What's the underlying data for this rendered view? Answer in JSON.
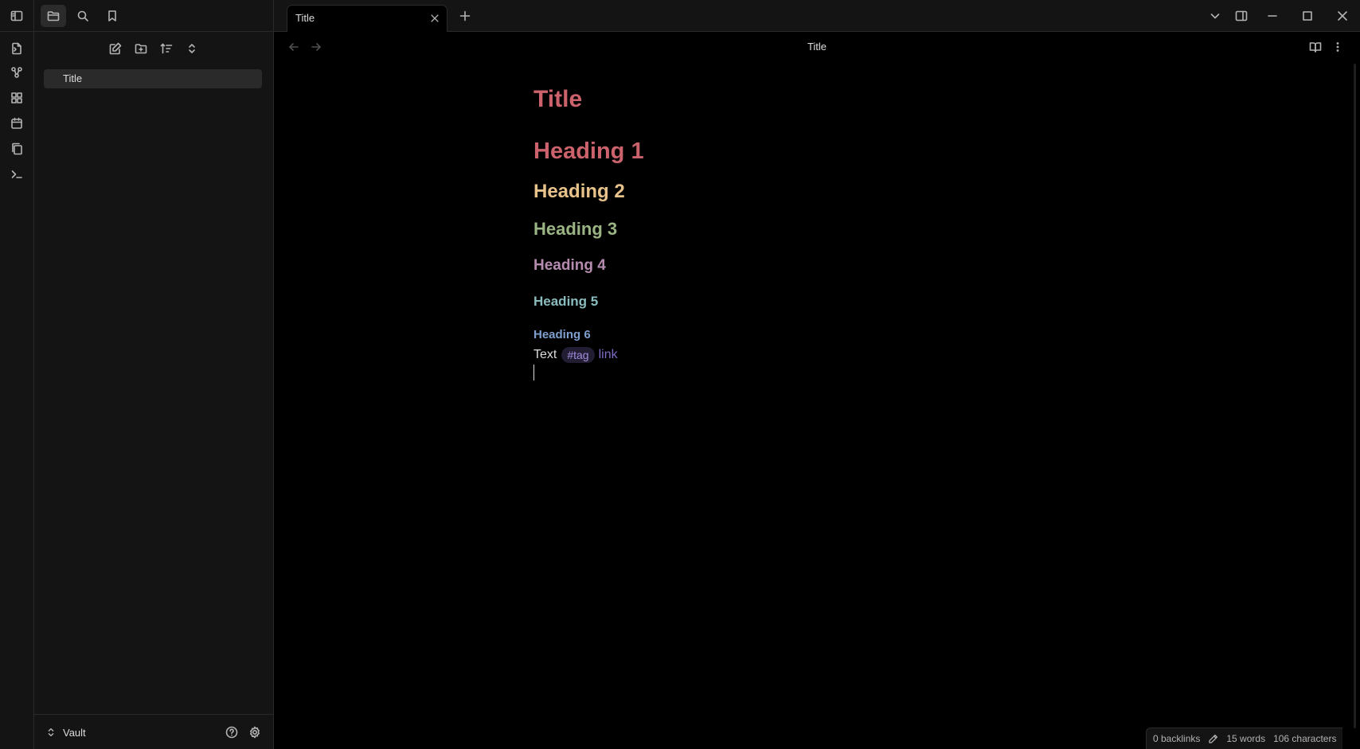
{
  "ribbon": {
    "items": [
      {
        "icon": "open-quick-switcher-icon"
      },
      {
        "icon": "graph-view-icon"
      },
      {
        "icon": "canvas-icon"
      },
      {
        "icon": "daily-note-icon"
      },
      {
        "icon": "templates-icon"
      },
      {
        "icon": "command-palette-icon"
      }
    ]
  },
  "sidebar": {
    "tabs": [
      {
        "icon": "files-icon",
        "active": true
      },
      {
        "icon": "search-icon",
        "active": false
      },
      {
        "icon": "bookmarks-icon",
        "active": false
      }
    ],
    "nav_actions": [
      "new-note-icon",
      "new-folder-icon",
      "sort-icon",
      "collapse-all-icon"
    ],
    "files": [
      {
        "name": "Title",
        "active": true
      }
    ],
    "footer": {
      "vault_name": "Vault"
    }
  },
  "tabbar": {
    "tabs": [
      {
        "title": "Title",
        "active": true
      }
    ]
  },
  "view": {
    "title": "Title"
  },
  "note": {
    "inline_title": "Title",
    "headings": [
      "Heading 1",
      "Heading 2",
      "Heading 3",
      "Heading 4",
      "Heading 5",
      "Heading 6"
    ],
    "body": {
      "text": "Text",
      "tag": "#tag",
      "link": "link"
    }
  },
  "status": {
    "backlinks": "0 backlinks",
    "words": "15 words",
    "characters": "106 characters"
  },
  "colors": {
    "background": "#000000",
    "sidebar_bg": "#141414",
    "h1": "#cb626c",
    "h2": "#e7c28a",
    "h3": "#9ab484",
    "h4": "#b58cb0",
    "h5": "#8abcbe",
    "h6": "#7ea0cf",
    "tag_text": "#a38de0",
    "link": "#7f6cc4"
  }
}
